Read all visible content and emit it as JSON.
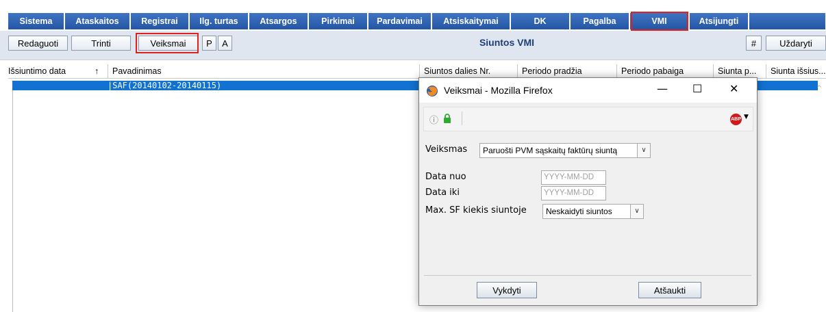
{
  "menu": {
    "items": [
      {
        "label": "Sistema"
      },
      {
        "label": "Ataskaitos"
      },
      {
        "label": "Registrai"
      },
      {
        "label": "Ilg. turtas"
      },
      {
        "label": "Atsargos"
      },
      {
        "label": "Pirkimai"
      },
      {
        "label": "Pardavimai"
      },
      {
        "label": "Atsiskaitymai"
      },
      {
        "label": "DK"
      },
      {
        "label": "Pagalba"
      },
      {
        "label": "VMI"
      },
      {
        "label": "Atsijungti"
      }
    ],
    "active": "VMI",
    "accent_color": "#2556a6",
    "highlight_color": "#e0201a"
  },
  "toolbar": {
    "edit_label": "Redaguoti",
    "delete_label": "Trinti",
    "actions_label": "Veiksmai",
    "p_label": "P",
    "a_label": "A",
    "title": "Siuntos VMI",
    "hash_label": "#",
    "close_label": "Uždaryti"
  },
  "grid": {
    "columns": [
      "Išsiuntimo data",
      "Pavadinimas",
      "Siuntos dalies Nr.",
      "Periodo pradžia",
      "Periodo pabaiga",
      "Siunta p...",
      "Siunta išsius..."
    ],
    "sort_icon": "↑",
    "rows": [
      {
        "name": "SAF(20140102-20140115)"
      }
    ],
    "selection_color": "#1172d2"
  },
  "dialog": {
    "title": "Veiksmai - Mozilla Firefox",
    "minimize": "—",
    "maximize": "☐",
    "close": "✕",
    "action_label": "Veiksmas",
    "action_value": "Paruošti PVM sąskaitų faktūrų siuntą",
    "date_from_label": "Data nuo",
    "date_from_placeholder": "YYYY-MM-DD",
    "date_to_label": "Data iki",
    "date_to_placeholder": "YYYY-MM-DD",
    "max_label": "Max. SF kiekis siuntoje",
    "max_value": "Neskaidyti siuntos",
    "execute_label": "Vykdyti",
    "cancel_label": "Atšaukti",
    "abp_label": "ABP"
  }
}
